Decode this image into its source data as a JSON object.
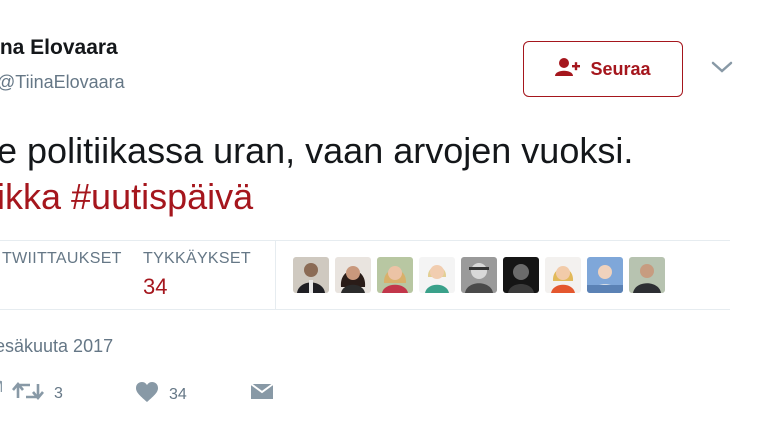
{
  "author": {
    "display_name": "ina Elovaara",
    "handle": "TiinaElovaara"
  },
  "follow_button": {
    "label": "Seuraa",
    "icon": "add-user-icon",
    "color": "#a5161d"
  },
  "tweet": {
    "line1": "e politiikassa uran, vaan arvojen vuoksi.",
    "line2_hashtags": "ikka #uutispäivä"
  },
  "stats": {
    "retweets_label": "TWIITTAUKSET",
    "likes_label": "TYKKÄYKSET",
    "likes_value": "34"
  },
  "liked_by_avatars": [
    "avatar-1",
    "avatar-2",
    "avatar-3",
    "avatar-4",
    "avatar-5",
    "avatar-6",
    "avatar-7",
    "avatar-8",
    "avatar-9"
  ],
  "date": "esäkuuta 2017",
  "actions": {
    "reply_icon": "reply-icon",
    "retweet_icon": "retweet-icon",
    "retweet_count": "3",
    "like_icon": "heart-icon",
    "like_count": "34",
    "message_icon": "envelope-icon"
  },
  "colors": {
    "accent": "#a5161d",
    "muted": "#657786",
    "text": "#14171a",
    "divider": "#e6ecf0"
  }
}
